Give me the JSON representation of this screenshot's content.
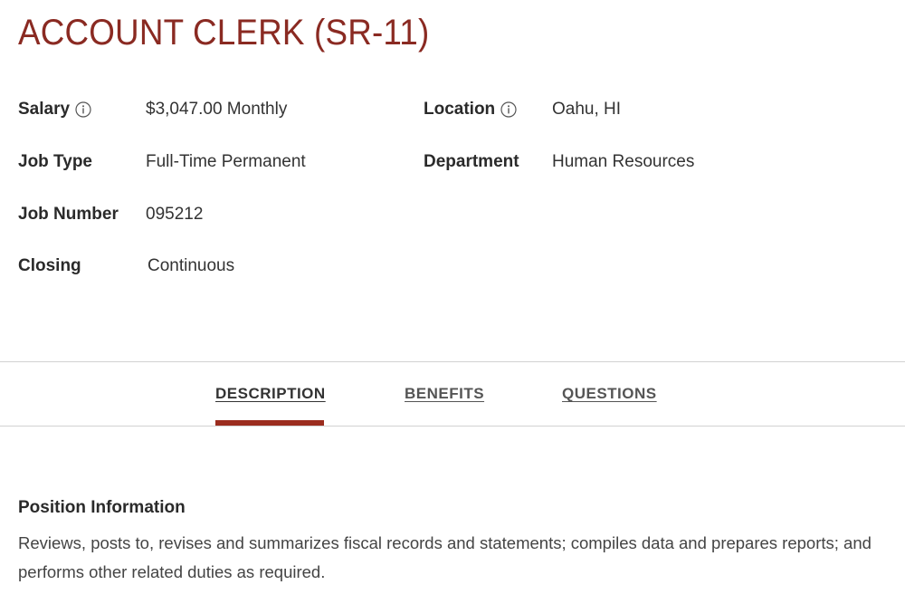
{
  "job": {
    "title": "ACCOUNT CLERK (SR-11)"
  },
  "details": {
    "salary": {
      "label": "Salary",
      "value": "$3,047.00 Monthly",
      "icon": "info-icon"
    },
    "location": {
      "label": "Location",
      "value": "Oahu, HI",
      "icon": "info-icon"
    },
    "job_type": {
      "label": "Job Type",
      "value": "Full-Time Permanent"
    },
    "department": {
      "label": "Department",
      "value": "Human Resources"
    },
    "job_number": {
      "label": "Job Number",
      "value": "095212"
    },
    "closing": {
      "label": "Closing",
      "value": "Continuous"
    }
  },
  "tabs": [
    {
      "label": "DESCRIPTION",
      "active": true
    },
    {
      "label": "BENEFITS",
      "active": false
    },
    {
      "label": "QUESTIONS",
      "active": false
    }
  ],
  "description": {
    "heading": "Position Information",
    "body": "Reviews, posts to, revises and summarizes fiscal records and statements; compiles data and prepares reports; and performs other related duties as required."
  },
  "colors": {
    "title": "#8a2a22",
    "accent": "#9b2c1e",
    "divider": "#d2d2d2"
  }
}
